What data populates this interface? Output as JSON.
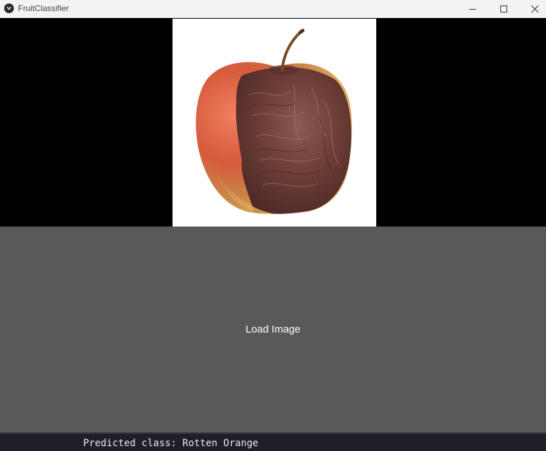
{
  "window": {
    "title": "FruitClassifier",
    "controls": {
      "minimize": "minimize-icon",
      "maximize": "maximize-icon",
      "close": "close-icon"
    }
  },
  "image_panel": {
    "image": "rotten-apple-photo",
    "background": "#000000"
  },
  "load_button": {
    "label": "Load Image",
    "color": "#595959"
  },
  "terminal": {
    "output": "Predicted class: Rotten Orange",
    "background": "#1e1f29"
  }
}
